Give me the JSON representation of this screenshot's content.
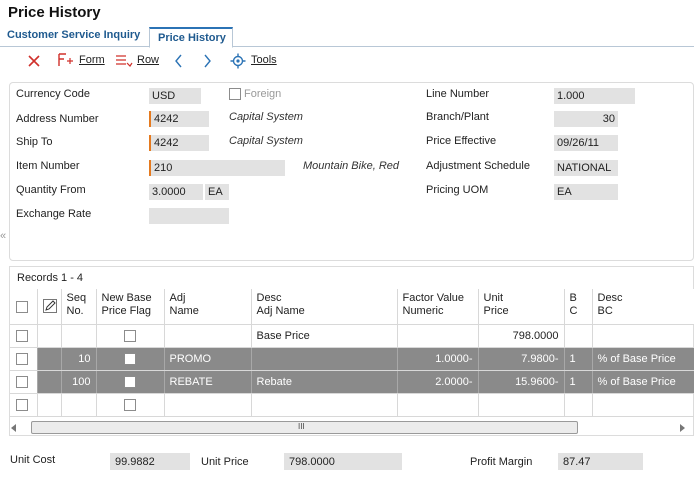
{
  "page": {
    "title": "Price History"
  },
  "tabs": [
    {
      "label": "Customer Service Inquiry"
    },
    {
      "label": "Price History"
    }
  ],
  "toolbar": {
    "form": "Form",
    "row": "Row",
    "tools": "Tools"
  },
  "header": {
    "currency_code_label": "Currency Code",
    "currency_code": "USD",
    "foreign_label": "Foreign",
    "address_number_label": "Address Number",
    "address_number": "4242",
    "address_name": "Capital System",
    "ship_to_label": "Ship To",
    "ship_to": "4242",
    "ship_to_name": "Capital System",
    "item_number_label": "Item Number",
    "item_number": "210",
    "item_desc": "Mountain Bike, Red",
    "quantity_from_label": "Quantity From",
    "quantity_from": "3.0000",
    "quantity_uom": "EA",
    "exchange_rate_label": "Exchange Rate",
    "exchange_rate": "",
    "line_number_label": "Line Number",
    "line_number": "1.000",
    "branch_plant_label": "Branch/Plant",
    "branch_plant": "30",
    "price_effective_label": "Price Effective",
    "price_effective": "09/26/11",
    "adjustment_schedule_label": "Adjustment Schedule",
    "adjustment_schedule": "NATIONAL",
    "pricing_uom_label": "Pricing UOM",
    "pricing_uom": "EA"
  },
  "grid": {
    "records": "Records 1 - 4",
    "columns": {
      "seq1": "Seq",
      "seq2": "No.",
      "nb1": "New Base",
      "nb2": "Price Flag",
      "adj1": "Adj",
      "adj2": "Name",
      "desc1": "Desc",
      "desc2": "Adj Name",
      "fv1": "Factor Value",
      "fv2": "Numeric",
      "up1": "Unit",
      "up2": "Price",
      "bc1": "B",
      "bc2": "C",
      "dbc1": "Desc",
      "dbc2": "BC"
    },
    "rows": [
      {
        "seq": "",
        "adj_name": "",
        "desc": "Base Price",
        "factor": "",
        "unit_price": "798.0000",
        "bc": "",
        "desc_bc": ""
      },
      {
        "seq": "10",
        "adj_name": "PROMO",
        "desc": "",
        "factor": "1.0000-",
        "unit_price": "7.9800-",
        "bc": "1",
        "desc_bc": "% of Base Price"
      },
      {
        "seq": "100",
        "adj_name": "REBATE",
        "desc": "Rebate",
        "factor": "2.0000-",
        "unit_price": "15.9600-",
        "bc": "1",
        "desc_bc": "% of Base Price"
      },
      {
        "seq": "",
        "adj_name": "",
        "desc": "",
        "factor": "",
        "unit_price": "",
        "bc": "",
        "desc_bc": ""
      }
    ],
    "scroll_grip": "III"
  },
  "footer": {
    "unit_cost_label": "Unit Cost",
    "unit_cost": "99.9882",
    "unit_price_label": "Unit Price",
    "unit_price": "798.0000",
    "profit_margin_label": "Profit Margin",
    "profit_margin": "87.47"
  }
}
